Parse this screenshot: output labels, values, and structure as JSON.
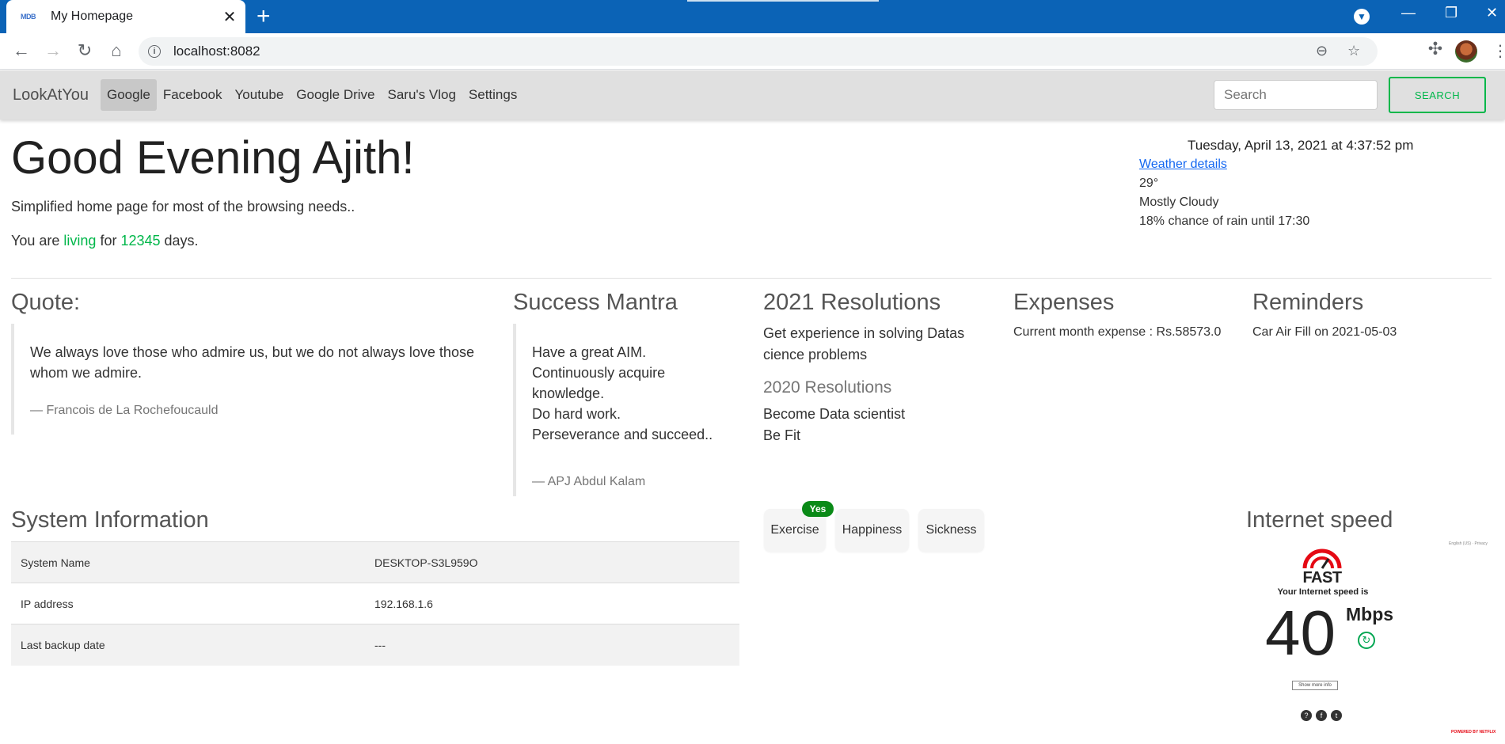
{
  "browser": {
    "tab_title": "My Homepage",
    "tab_favicon_text": "MDB",
    "url": "localhost:8082"
  },
  "app": {
    "brand": "LookAtYou",
    "nav": [
      "Google",
      "Facebook",
      "Youtube",
      "Google Drive",
      "Saru's Vlog",
      "Settings"
    ],
    "active_nav": "Google",
    "search_placeholder": "Search",
    "search_button": "SEARCH"
  },
  "hero": {
    "greeting": "Good Evening Ajith!",
    "subtitle": "Simplified home page for most of the browsing needs..",
    "living_prefix": "You are ",
    "living_word": "living",
    "living_mid": " for ",
    "living_days": "12345",
    "living_suffix": " days."
  },
  "weather": {
    "datetime": "Tuesday, April 13, 2021 at 4:37:52 pm",
    "link": "Weather details",
    "temp": "29°",
    "condition": "Mostly Cloudy",
    "rain": "18% chance of rain until 17:30"
  },
  "quote": {
    "heading": "Quote:",
    "text": "We always love those who admire us, but we do not always love those whom we admire.",
    "author": "— Francois de La Rochefoucauld"
  },
  "mantra": {
    "heading": "Success Mantra",
    "lines": [
      "Have a great AIM.",
      "Continuously acquire knowledge.",
      "Do hard work.",
      "Perseverance and succeed.."
    ],
    "author": "— APJ Abdul Kalam"
  },
  "resolutions": {
    "heading": "2021 Resolutions",
    "item": "Get experience in solving Datas cience problems",
    "prev_heading": "2020 Resolutions",
    "prev_items": [
      "Become Data scientist",
      "Be Fit"
    ]
  },
  "expenses": {
    "heading": "Expenses",
    "text": "Current month expense : Rs.58573.0"
  },
  "reminders": {
    "heading": "Reminders",
    "text": "Car Air Fill on 2021-05-03"
  },
  "system": {
    "heading": "System Information",
    "rows": [
      {
        "label": "System Name",
        "value": "DESKTOP-S3L959O"
      },
      {
        "label": "IP address",
        "value": "192.168.1.6"
      },
      {
        "label": "Last backup date",
        "value": "---"
      }
    ]
  },
  "habits": {
    "items": [
      "Exercise",
      "Happiness",
      "Sickness"
    ],
    "badge": "Yes"
  },
  "speed": {
    "heading": "Internet speed",
    "logo": "FAST",
    "caption": "Your Internet speed is",
    "value": "40",
    "unit": "Mbps",
    "more": "Show more info",
    "top_links": "English (US) ·  Privacy",
    "powered": "POWERED BY NETFLIX"
  }
}
